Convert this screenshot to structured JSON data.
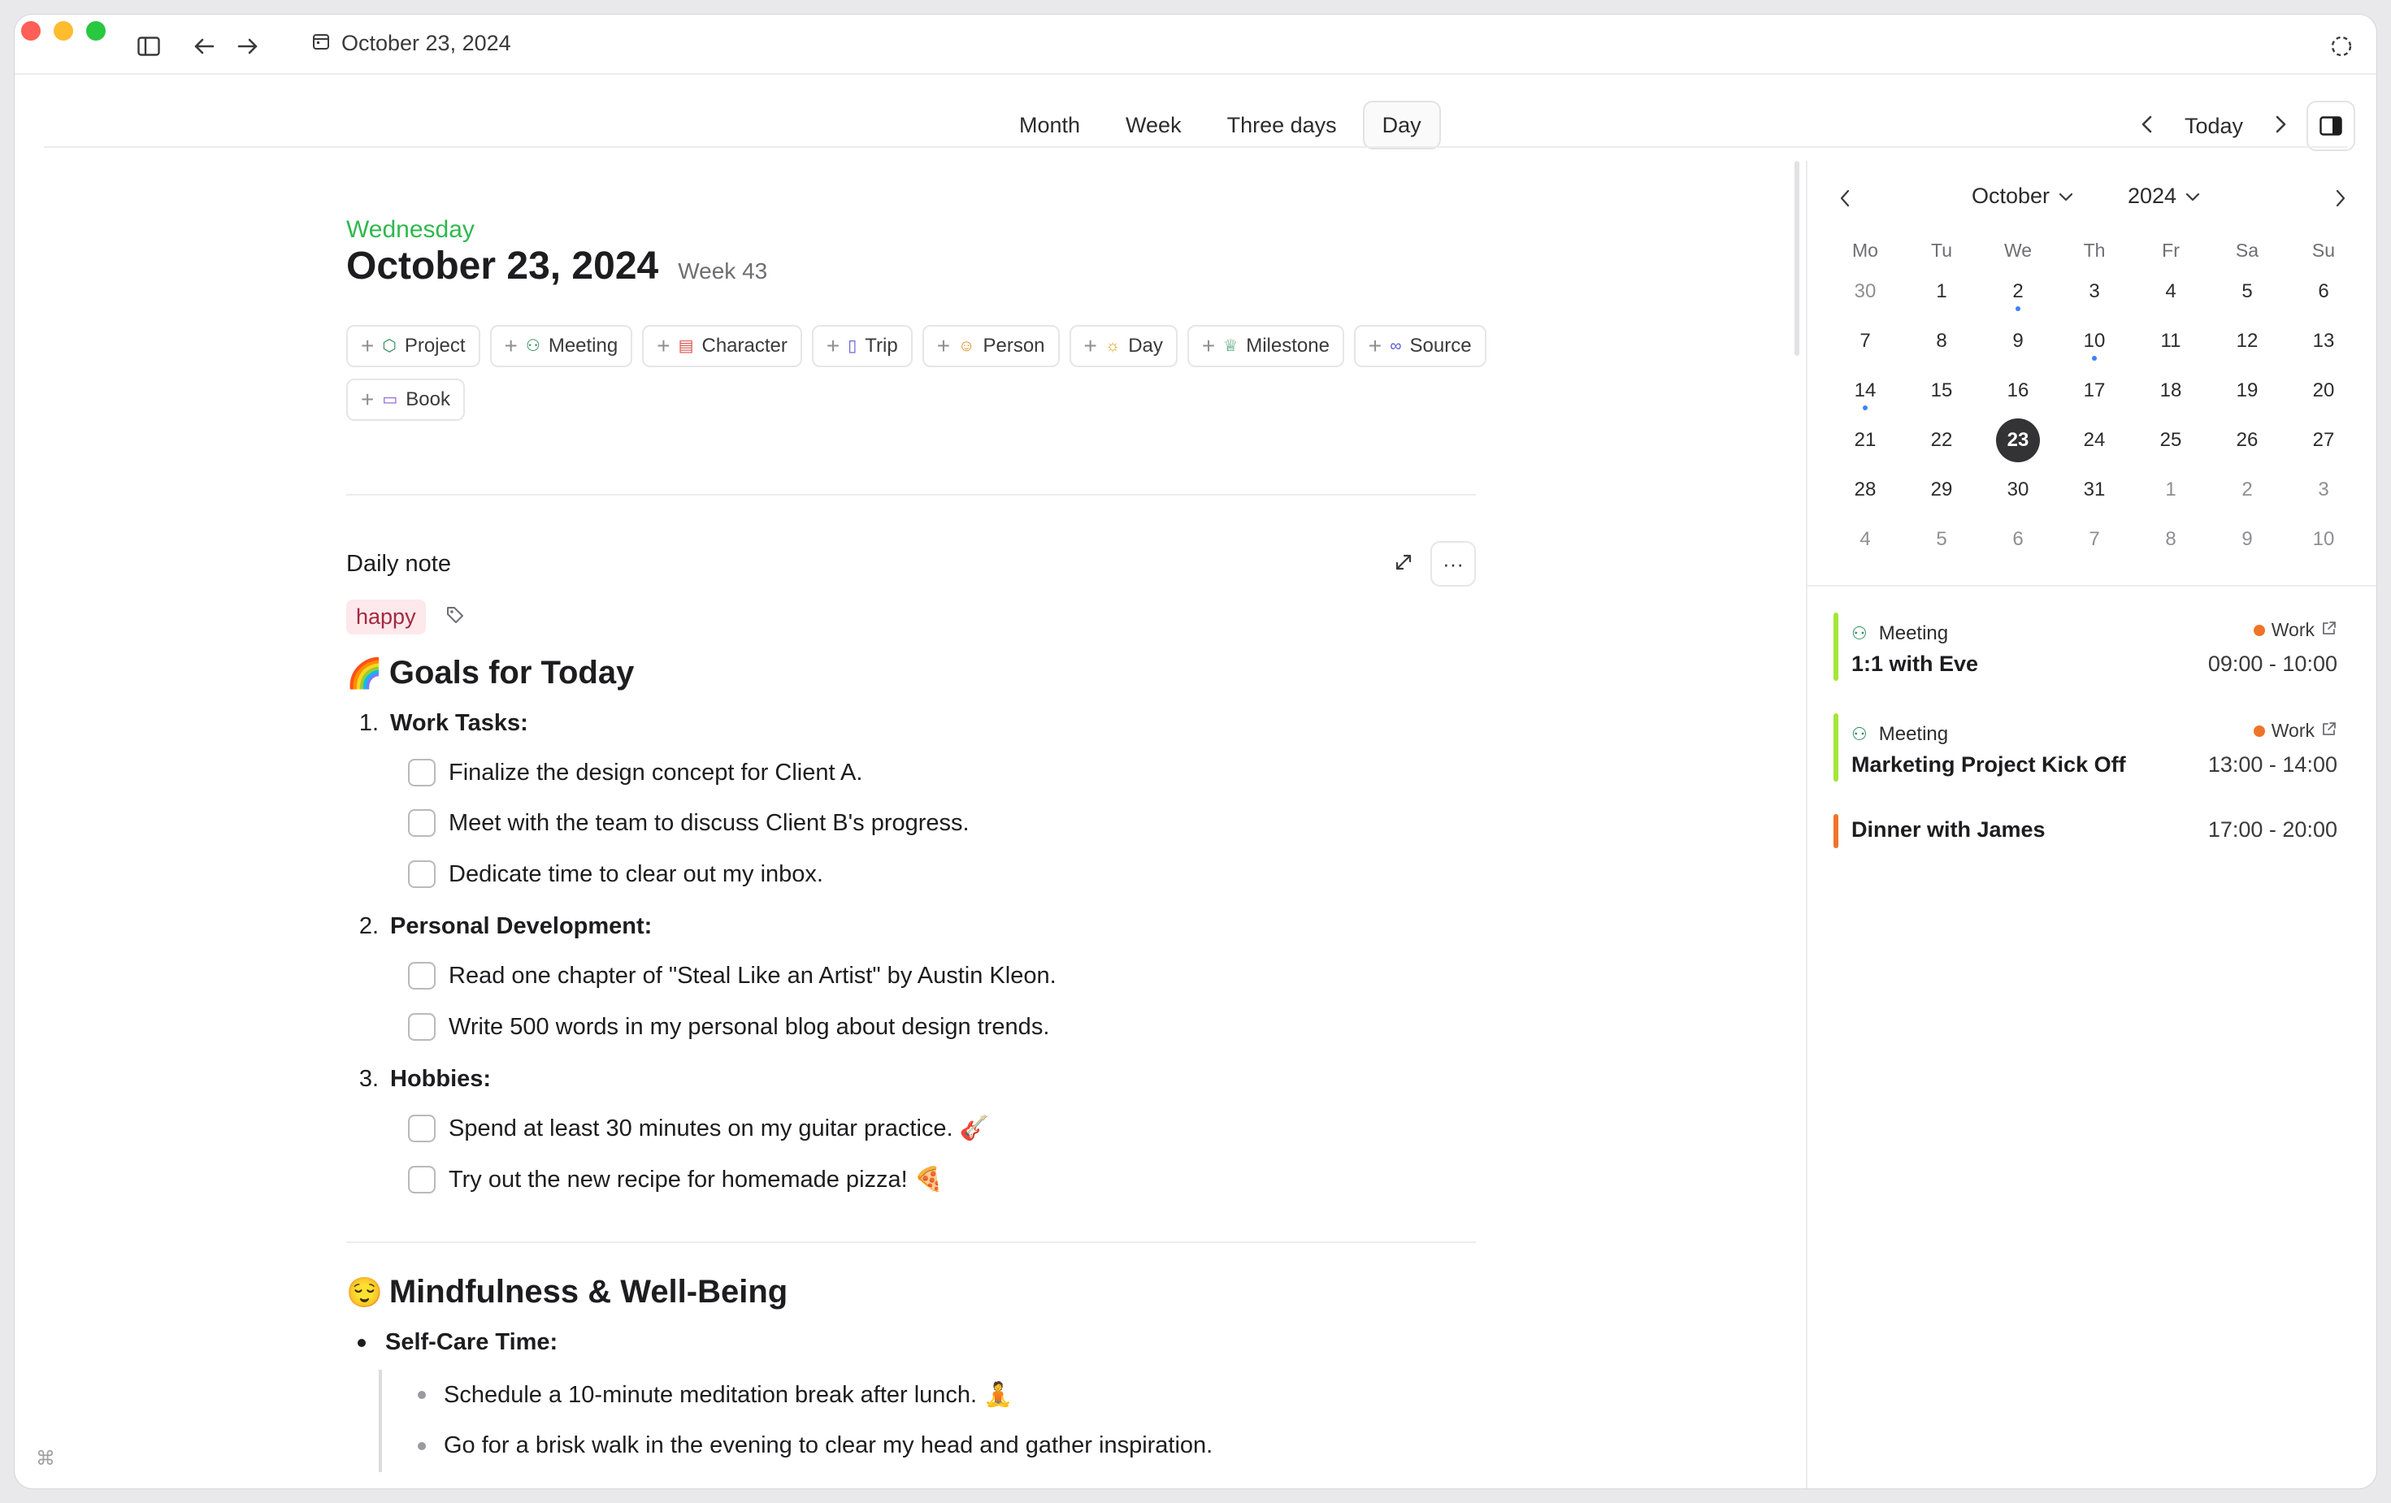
{
  "window": {
    "title": "October 23, 2024"
  },
  "views": {
    "tabs": [
      "Month",
      "Week",
      "Three days",
      "Day"
    ],
    "active": "Day",
    "today_label": "Today"
  },
  "day": {
    "weekday": "Wednesday",
    "date": "October 23, 2024",
    "week": "Week 43"
  },
  "chips": [
    {
      "label": "Project",
      "icon": "cube-icon",
      "glyph": "⬡",
      "color": "#2e8b57"
    },
    {
      "label": "Meeting",
      "icon": "people-icon",
      "glyph": "👥",
      "color": "#2e8b57"
    },
    {
      "label": "Character",
      "icon": "id-card-icon",
      "glyph": "🪪",
      "color": "#d9534f"
    },
    {
      "label": "Trip",
      "icon": "luggage-icon",
      "glyph": "🧳",
      "color": "#5b5bd6"
    },
    {
      "label": "Person",
      "icon": "person-icon",
      "glyph": "👤",
      "color": "#e08a1e"
    },
    {
      "label": "Day",
      "icon": "sun-icon",
      "glyph": "☀",
      "color": "#e0a21e"
    },
    {
      "label": "Milestone",
      "icon": "trophy-icon",
      "glyph": "🏆",
      "color": "#2e8b57"
    },
    {
      "label": "Source",
      "icon": "binoculars-icon",
      "glyph": "🔭",
      "color": "#5b5bd6"
    },
    {
      "label": "Book",
      "icon": "book-icon",
      "glyph": "📖",
      "color": "#8a5bd6"
    }
  ],
  "daily_note": {
    "title": "Daily note",
    "tag": "happy",
    "goals": {
      "emoji": "🌈",
      "heading": "Goals for Today",
      "sections": [
        {
          "num": "1.",
          "label": "Work Tasks:",
          "tasks": [
            "Finalize the design concept for Client A.",
            "Meet with the team to discuss Client B's progress.",
            "Dedicate time to clear out my inbox."
          ]
        },
        {
          "num": "2.",
          "label": "Personal Development:",
          "tasks": [
            "Read one chapter of \"Steal Like an Artist\" by Austin Kleon.",
            "Write 500 words in my personal blog about design trends."
          ]
        },
        {
          "num": "3.",
          "label": "Hobbies:",
          "tasks": [
            "Spend at least 30 minutes on my guitar practice. 🎸",
            "Try out the new recipe for homemade pizza! 🍕"
          ]
        }
      ]
    },
    "mindfulness": {
      "emoji": "😌",
      "heading": "Mindfulness & Well-Being",
      "label": "Self-Care Time:",
      "items": [
        "Schedule a 10-minute meditation break after lunch. 🧘",
        "Go for a brisk walk in the evening to clear my head and gather inspiration."
      ]
    }
  },
  "mini_calendar": {
    "month": "October",
    "year": "2024",
    "dow": [
      "Mo",
      "Tu",
      "We",
      "Th",
      "Fr",
      "Sa",
      "Su"
    ],
    "weeks": [
      [
        "30",
        "1",
        "2",
        "3",
        "4",
        "5",
        "6"
      ],
      [
        "7",
        "8",
        "9",
        "10",
        "11",
        "12",
        "13"
      ],
      [
        "14",
        "15",
        "16",
        "17",
        "18",
        "19",
        "20"
      ],
      [
        "21",
        "22",
        "23",
        "24",
        "25",
        "26",
        "27"
      ],
      [
        "28",
        "29",
        "30",
        "31",
        "1",
        "2",
        "3"
      ],
      [
        "4",
        "5",
        "6",
        "7",
        "8",
        "9",
        "10"
      ]
    ],
    "selected": "23",
    "event_days": [
      "2",
      "10",
      "14"
    ]
  },
  "events": [
    {
      "type": "Meeting",
      "calendar": "Work",
      "title": "1:1 with Eve",
      "time": "09:00 - 10:00",
      "color": "#a3e635"
    },
    {
      "type": "Meeting",
      "calendar": "Work",
      "title": "Marketing Project Kick Off",
      "time": "13:00 - 14:00",
      "color": "#a3e635"
    },
    {
      "type": "",
      "calendar": "",
      "title": "Dinner with James",
      "time": "17:00 - 20:00",
      "color": "#f0732a"
    }
  ],
  "shortcut_hint": "⌘"
}
